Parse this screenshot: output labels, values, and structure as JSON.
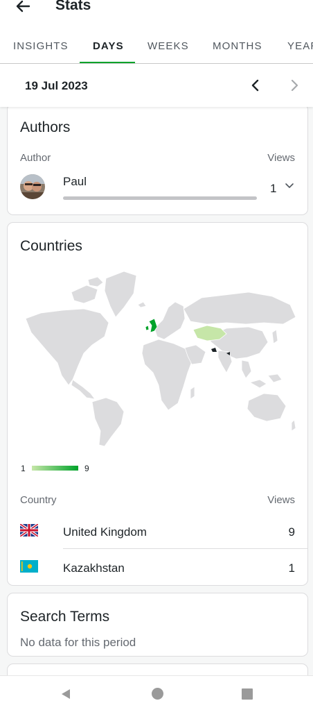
{
  "header": {
    "title": "Stats"
  },
  "tabs": [
    {
      "label": "INSIGHTS"
    },
    {
      "label": "DAYS"
    },
    {
      "label": "WEEKS"
    },
    {
      "label": "MONTHS"
    },
    {
      "label": "YEARS"
    }
  ],
  "date_bar": {
    "date": "19 Jul 2023"
  },
  "authors": {
    "title": "Authors",
    "col_author": "Author",
    "col_views": "Views",
    "items": [
      {
        "name": "Paul",
        "views": "1",
        "bar_fraction": 1.0
      }
    ]
  },
  "countries": {
    "title": "Countries",
    "legend_min": "1",
    "legend_max": "9",
    "col_country": "Country",
    "col_views": "Views",
    "colors": {
      "max": "#00a32a",
      "min": "#c6e6a8",
      "land": "#dcdcde"
    },
    "items": [
      {
        "name": "United Kingdom",
        "views": "9",
        "flag": "uk-flag-icon"
      },
      {
        "name": "Kazakhstan",
        "views": "1",
        "flag": "kazakhstan-flag-icon"
      }
    ]
  },
  "search_terms": {
    "title": "Search Terms",
    "empty": "No data for this period"
  },
  "theme": {
    "accent": "#00a32a"
  }
}
